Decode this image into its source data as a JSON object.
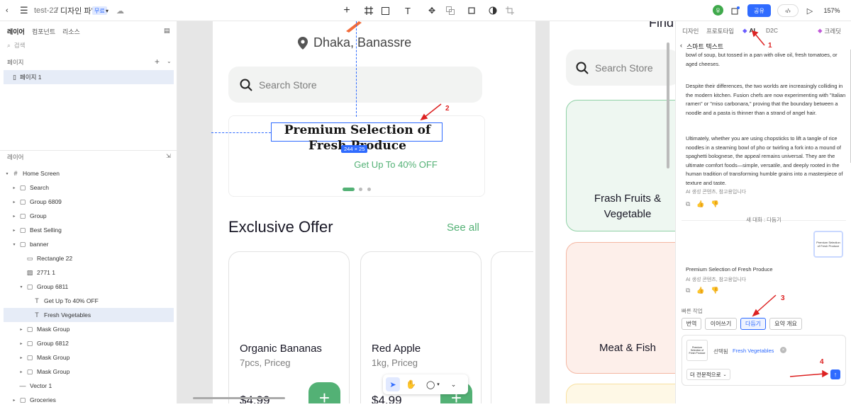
{
  "topbar": {
    "project": "test-22",
    "separator": "/",
    "file": "디자인 파일",
    "plan_badge": "무료",
    "zoom": "157%",
    "share_label": "공유",
    "avatar": "유"
  },
  "left": {
    "tabs": [
      "레이어",
      "컴포넌트",
      "리소스"
    ],
    "search_placeholder": "검색",
    "pages_title": "페이지",
    "page_item": "페이지 1",
    "layers_title": "레이어",
    "layers": [
      {
        "label": "Home Screen",
        "indent": 0,
        "type": "frame",
        "caret": "▾"
      },
      {
        "label": "Search",
        "indent": 1,
        "type": "group",
        "caret": "▸"
      },
      {
        "label": "Group 6809",
        "indent": 1,
        "type": "group",
        "caret": "▸"
      },
      {
        "label": "Group",
        "indent": 1,
        "type": "group",
        "caret": "▸"
      },
      {
        "label": "Best Selling",
        "indent": 1,
        "type": "group",
        "caret": "▸"
      },
      {
        "label": "banner",
        "indent": 1,
        "type": "group",
        "caret": "▾"
      },
      {
        "label": "Rectangle 22",
        "indent": 2,
        "type": "rect",
        "caret": ""
      },
      {
        "label": "2771 1",
        "indent": 2,
        "type": "image",
        "caret": ""
      },
      {
        "label": "Group 6811",
        "indent": 2,
        "type": "group",
        "caret": "▾"
      },
      {
        "label": "Get Up To 40% OFF",
        "indent": 3,
        "type": "text",
        "caret": ""
      },
      {
        "label": "Fresh Vegetables",
        "indent": 3,
        "type": "text",
        "caret": "",
        "selected": true
      },
      {
        "label": "Mask Group",
        "indent": 2,
        "type": "group",
        "caret": "▸"
      },
      {
        "label": "Group 6812",
        "indent": 2,
        "type": "group",
        "caret": "▸"
      },
      {
        "label": "Mask Group",
        "indent": 2,
        "type": "group",
        "caret": "▸"
      },
      {
        "label": "Mask Group",
        "indent": 2,
        "type": "group",
        "caret": "▸"
      },
      {
        "label": "Vector 1",
        "indent": 1,
        "type": "vector",
        "caret": ""
      },
      {
        "label": "Groceries",
        "indent": 1,
        "type": "group",
        "caret": "▸"
      }
    ]
  },
  "canvas": {
    "location": "Dhaka, Banassre",
    "search_placeholder": "Search Store",
    "banner_title": "Premium Selection of Fresh Produce",
    "banner_sub": "Get Up To 40% OFF",
    "size_label": "244 × 25",
    "section_title": "Exclusive Offer",
    "see_all": "See all",
    "products": [
      {
        "name": "Organic Bananas",
        "qty": "7pcs, Priceg",
        "price": "$4.99"
      },
      {
        "name": "Red Apple",
        "qty": "1kg, Priceg",
        "price": "$4.99"
      }
    ],
    "frame2": {
      "title": "Find",
      "search_placeholder": "Search Store",
      "cat1": "Frash Fruits & Vegetable",
      "cat2": "Meat & Fish"
    }
  },
  "right": {
    "tabs": [
      "디자인",
      "프로토타입",
      "AI",
      "D2C"
    ],
    "credit": "크레딧",
    "header": "스마트 텍스트",
    "para0": "bowl of soup, but tossed in a pan with olive oil, fresh tomatoes, or aged cheeses.",
    "para1": "Despite their differences, the two worlds are increasingly colliding in the modern kitchen. Fusion chefs are now experimenting with \"Italian ramen\" or \"miso carbonara,\" proving that the boundary between a noodle and a pasta is thinner than a strand of angel hair.",
    "para2": "Ultimately, whether you are using chopsticks to lift a tangle of rice noodles in a steaming bowl of pho or twirling a fork into a mound of spaghetti bolognese, the appeal remains universal. They are the ultimate comfort foods—simple, versatile, and deeply rooted in the human tradition of transforming humble grains into a masterpiece of texture and taste.",
    "ai_note": "AI 생성 콘텐츠, 참고용입니다",
    "new_chat": "새 대화 : 다듬기",
    "result_text": "Premium Selection of Fresh Produce",
    "quick_title": "빠른 작업",
    "quick": [
      "번역",
      "이어쓰기",
      "다듬기",
      "요약 개요"
    ],
    "selected_label": "선택됨",
    "selected_value": "Fresh Vegetables",
    "tone": "더 전문적으로",
    "thumb_text": "Premium Selection of Fresh Produce"
  },
  "annotations": [
    "1",
    "2",
    "3",
    "4"
  ],
  "colors": {
    "accent": "#53B175",
    "primary": "#2F6BFF",
    "red": "#DD2222"
  }
}
